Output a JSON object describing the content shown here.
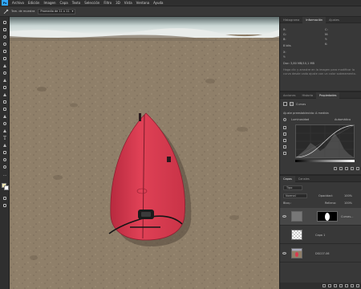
{
  "menubar": {
    "logo": "Ps",
    "items": [
      "Archivo",
      "Edición",
      "Imagen",
      "Capa",
      "Texto",
      "Selección",
      "Filtro",
      "3D",
      "Vista",
      "Ventana",
      "Ayuda"
    ]
  },
  "options": {
    "size_label": "Tam. de muestra",
    "sample_value": "Promedio de 11 x 11"
  },
  "panels": {
    "top_tabs": [
      "Histograma",
      "Información",
      "Ajustes"
    ],
    "info_rows": [
      "R:",
      "G:",
      "B:",
      "8 bits"
    ],
    "info_rows_right": [
      "C:",
      "M:",
      "Y:",
      "K:"
    ],
    "info_xy": [
      "X:",
      "Y:"
    ],
    "doc": "Doc: 3,80 MB/10,1 MB",
    "hint": "Haga clic y arrastre en la imagen para modificar la curva desde cada ajuste con un color sobreamento.",
    "mid_tabs": [
      "Acciones",
      "Historia",
      "Propiedades"
    ],
    "prop_title": "Curvas",
    "preset_label": "Ajuste preestablecido:",
    "preset_value": "A medida",
    "channel_value": "Luminosidad",
    "auto_label": "Automático",
    "layer_tabs": [
      "Capas",
      "Canales"
    ],
    "filter_label": "Tipo",
    "mode_value": "Normal",
    "opacity_label": "Opacidad:",
    "opacity_value": "100%",
    "fill_label": "Relleno:",
    "fill_value": "100%",
    "lock_label": "Bloq.:",
    "layers": [
      {
        "name": "Curvas..."
      },
      {
        "name": "Capa 1"
      },
      {
        "name": "DSC07-06"
      }
    ]
  },
  "colors": {
    "board": "#d9394f",
    "accent": "#31a8ff"
  }
}
